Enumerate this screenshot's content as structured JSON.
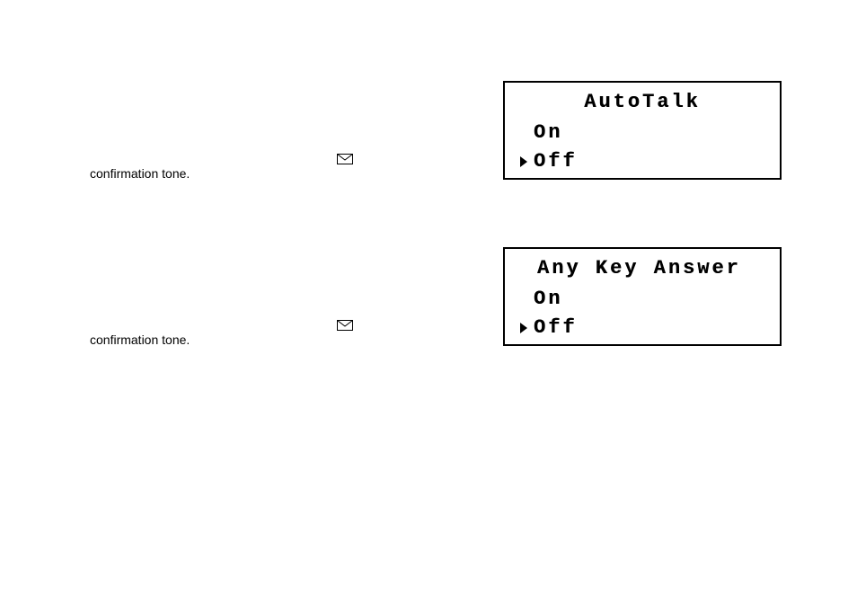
{
  "sections": [
    {
      "body_text": "confirmation tone.",
      "icon": "envelope-icon",
      "lcd": {
        "title": "AutoTalk",
        "options": [
          {
            "label": "On",
            "selected": false
          },
          {
            "label": "Off",
            "selected": true
          }
        ]
      }
    },
    {
      "body_text": "confirmation tone.",
      "icon": "envelope-icon",
      "lcd": {
        "title": "Any Key Answer",
        "options": [
          {
            "label": "On",
            "selected": false
          },
          {
            "label": "Off",
            "selected": true
          }
        ]
      }
    }
  ]
}
